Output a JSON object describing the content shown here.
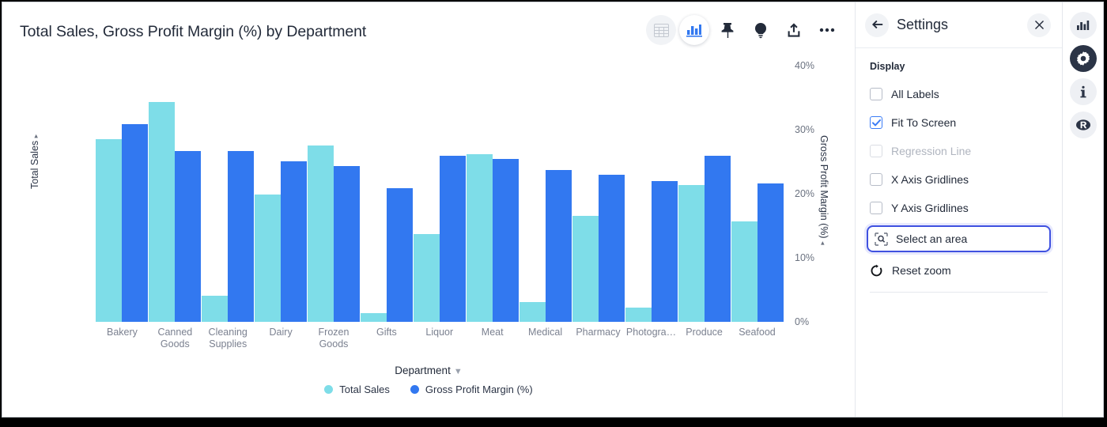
{
  "chart_data": {
    "type": "bar",
    "title": "Total Sales, Gross Profit Margin (%) by Department",
    "xlabel": "Department",
    "categories": [
      "Bakery",
      "Canned Goods",
      "Cleaning Supplies",
      "Dairy",
      "Frozen Goods",
      "Gifts",
      "Liquor",
      "Meat",
      "Medical",
      "Pharmacy",
      "Photogra…",
      "Produce",
      "Seafood"
    ],
    "grid": false,
    "legend_position": "bottom",
    "series": [
      {
        "name": "Total Sales",
        "color": "#7edde8",
        "axis": "left",
        "ylabel": "Total Sales",
        "ylim": [
          0,
          6000000
        ],
        "yticks": [
          "0",
          "2000000",
          "4000000",
          "6000000"
        ],
        "values": [
          4150000,
          5000000,
          600000,
          2900000,
          4000000,
          200000,
          2000000,
          3800000,
          450000,
          2400000,
          330000,
          3100000,
          2280000
        ]
      },
      {
        "name": "Gross Profit Margin (%)",
        "color": "#3278f0",
        "axis": "right",
        "ylabel": "Gross Profit Margin (%)",
        "ylim": [
          0,
          40
        ],
        "yticks": [
          "0%",
          "10%",
          "20%",
          "30%",
          "40%"
        ],
        "values": [
          30.0,
          25.9,
          25.9,
          24.3,
          23.6,
          20.3,
          25.2,
          24.7,
          23.0,
          22.3,
          21.3,
          25.2,
          21.0
        ]
      }
    ]
  },
  "toolbar": {
    "items": [
      {
        "icon": "table-icon",
        "label": "Table view"
      },
      {
        "icon": "bar-chart-icon",
        "label": "Chart view"
      },
      {
        "icon": "pin-icon",
        "label": "Pin"
      },
      {
        "icon": "lightbulb-icon",
        "label": "Insights"
      },
      {
        "icon": "share-icon",
        "label": "Share"
      },
      {
        "icon": "more-icon",
        "label": "More options"
      }
    ]
  },
  "settings": {
    "back_label": "←",
    "title": "Settings",
    "close_label": "×",
    "section_label": "Display",
    "options": [
      {
        "label": "All Labels",
        "checked": false,
        "disabled": false
      },
      {
        "label": "Fit To Screen",
        "checked": true,
        "disabled": false
      },
      {
        "label": "Regression Line",
        "checked": false,
        "disabled": true
      },
      {
        "label": "X Axis Gridlines",
        "checked": false,
        "disabled": false
      },
      {
        "label": "Y Axis Gridlines",
        "checked": false,
        "disabled": false
      }
    ],
    "select_area_label": "Select an area",
    "reset_zoom_label": "Reset zoom"
  },
  "rail": {
    "items": [
      {
        "icon": "bar-chart-icon",
        "label": "Visualization",
        "active": false
      },
      {
        "icon": "gear-icon",
        "label": "Settings",
        "active": true
      },
      {
        "icon": "info-icon",
        "label": "Info",
        "active": false
      },
      {
        "icon": "r-logo-icon",
        "label": "R",
        "active": false
      }
    ]
  },
  "colors": {
    "series_a": "#7edde8",
    "series_b": "#3278f0",
    "accent": "#3f51e0",
    "checkbox_checked": "#3b7cf6"
  }
}
